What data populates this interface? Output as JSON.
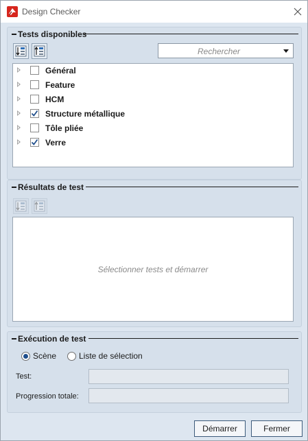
{
  "window": {
    "title": "Design Checker",
    "app_icon": "app-logo-icon",
    "close_icon": "close-icon"
  },
  "tests_panel": {
    "title": "Tests disponibles",
    "toolbar": {
      "expand_icon": "expand-all-icon",
      "collapse_icon": "collapse-all-icon"
    },
    "search": {
      "placeholder": "Rechercher",
      "icon": "chevron-down-icon"
    },
    "tree": [
      {
        "label": "Général",
        "checked": false
      },
      {
        "label": "Feature",
        "checked": false
      },
      {
        "label": "HCM",
        "checked": false
      },
      {
        "label": "Structure métallique",
        "checked": true
      },
      {
        "label": "Tôle pliée",
        "checked": false
      },
      {
        "label": "Verre",
        "checked": true
      }
    ]
  },
  "results_panel": {
    "title": "Résultats de test",
    "toolbar": {
      "expand_icon": "expand-all-icon",
      "collapse_icon": "collapse-all-icon"
    },
    "empty_message": "Sélectionner tests et démarrer"
  },
  "execution_panel": {
    "title": "Exécution de test",
    "radios": [
      {
        "label": "Scène",
        "selected": true
      },
      {
        "label": "Liste de sélection",
        "selected": false
      }
    ],
    "fields": [
      {
        "label": "Test:",
        "value": ""
      },
      {
        "label": "Progression totale:",
        "value": ""
      }
    ]
  },
  "buttons": {
    "start": "Démarrer",
    "close": "Fermer"
  },
  "colors": {
    "client_bg": "#dde6f0",
    "panel_bg": "#d6e0eb",
    "check_accent": "#1f4e8c",
    "brand_red": "#d7261e"
  }
}
